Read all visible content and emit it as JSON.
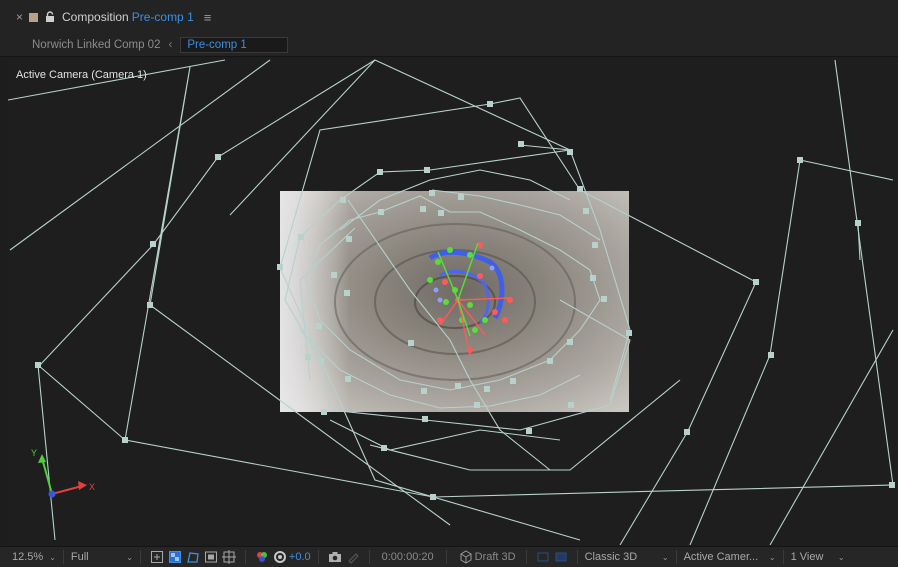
{
  "header": {
    "close_icon": "×",
    "label_color": "#b6a486",
    "panel_label": "Composition",
    "comp_name": "Pre-comp 1",
    "menu_icon": "≡"
  },
  "tabs": {
    "parent": "Norwich Linked Comp 02",
    "back_icon": "‹",
    "active": "Pre-comp 1"
  },
  "viewer": {
    "camera_label": "Active Camera (Camera 1)",
    "axis_y": "Y",
    "axis_x": "X",
    "colors": {
      "bg": "#1e1e1e",
      "path": "#b7d1cc",
      "accent": "#3d8fe0"
    }
  },
  "status_bar": {
    "zoom": "12.5%",
    "resolution": "Full",
    "exposure": "+0.0",
    "timecode": "0:00:00:20",
    "draft_3d": "Draft 3D",
    "renderer": "Classic 3D",
    "view": "Active Camer...",
    "layout": "1 View",
    "dropdown_icon": "⌄"
  }
}
